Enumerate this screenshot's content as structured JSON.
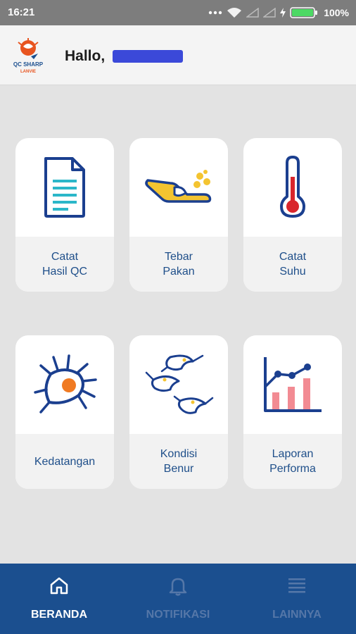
{
  "status_bar": {
    "time": "16:21",
    "battery": "100%",
    "icons": [
      "more-dots-icon",
      "wifi-icon",
      "signal-icon",
      "signal-icon",
      "charging-icon",
      "battery-icon"
    ]
  },
  "header": {
    "logo_text_line1": "QC SHARP",
    "logo_text_line2": "LANVIE",
    "greeting": "Hallo,"
  },
  "menu": {
    "items": [
      {
        "line1": "Catat",
        "line2": "Hasil QC",
        "icon": "document-icon"
      },
      {
        "line1": "Tebar",
        "line2": "Pakan",
        "icon": "feed-icon"
      },
      {
        "line1": "Catat",
        "line2": "Suhu",
        "icon": "thermometer-icon"
      },
      {
        "line1": "Kedatangan",
        "line2": "",
        "icon": "plankton-icon"
      },
      {
        "line1": "Kondisi",
        "line2": "Benur",
        "icon": "shrimp-icon"
      },
      {
        "line1": "Laporan",
        "line2": "Performa",
        "icon": "chart-icon"
      }
    ]
  },
  "bottom_nav": {
    "items": [
      {
        "label": "BERANDA",
        "icon": "home-icon",
        "active": true
      },
      {
        "label": "NOTIFIKASI",
        "icon": "bell-icon",
        "active": false
      },
      {
        "label": "LAINNYA",
        "icon": "menu-icon",
        "active": false
      }
    ]
  },
  "colors": {
    "primary": "#1b4f8f",
    "label_text": "#1f4f8a",
    "accent_orange": "#f07a22",
    "accent_yellow": "#f4c430",
    "accent_red": "#d9262c",
    "accent_pink": "#f28b93"
  }
}
